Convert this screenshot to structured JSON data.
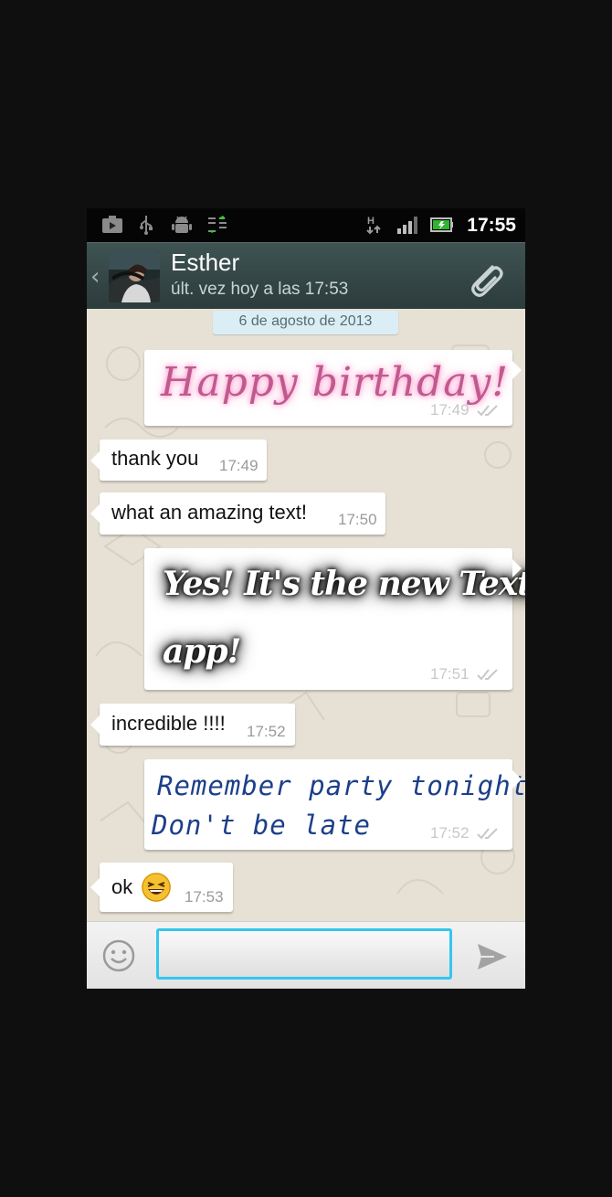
{
  "status_bar": {
    "time": "17:55",
    "network_type": "H",
    "icons": [
      "media-play-icon",
      "usb-icon",
      "android-debug-icon",
      "sync-icon",
      "data-transfer-icon",
      "signal-icon",
      "battery-icon"
    ]
  },
  "header": {
    "contact_name": "Esther",
    "last_seen": "últ. vez hoy a las 17:53",
    "back_icon": "‹"
  },
  "chat": {
    "date_separator": "6 de agosto de 2013",
    "messages": [
      {
        "direction": "out",
        "type": "textart",
        "text": "Happy birthday!",
        "time": "17:49",
        "status": "delivered"
      },
      {
        "direction": "in",
        "type": "text",
        "text": "thank you",
        "time": "17:49"
      },
      {
        "direction": "in",
        "type": "text",
        "text": "what an amazing text!",
        "time": "17:50"
      },
      {
        "direction": "out",
        "type": "textart",
        "text_line1": "Yes! It's the new TextArt",
        "text_line2": "app!",
        "time": "17:51",
        "status": "delivered"
      },
      {
        "direction": "in",
        "type": "text",
        "text": "incredible !!!!",
        "time": "17:52"
      },
      {
        "direction": "out",
        "type": "textart",
        "text_line1": "Remember party tonight",
        "text_line2": "Don't be late",
        "time": "17:52",
        "status": "delivered"
      },
      {
        "direction": "in",
        "type": "text",
        "text": "ok",
        "emoji": "laughing-face",
        "time": "17:53"
      }
    ]
  },
  "input_bar": {
    "placeholder": "",
    "value": ""
  },
  "colors": {
    "header_bg": "#34474a",
    "chat_bg": "#e6e0d5",
    "input_focus": "#33c7ee",
    "status_bar_bg": "#050505"
  }
}
